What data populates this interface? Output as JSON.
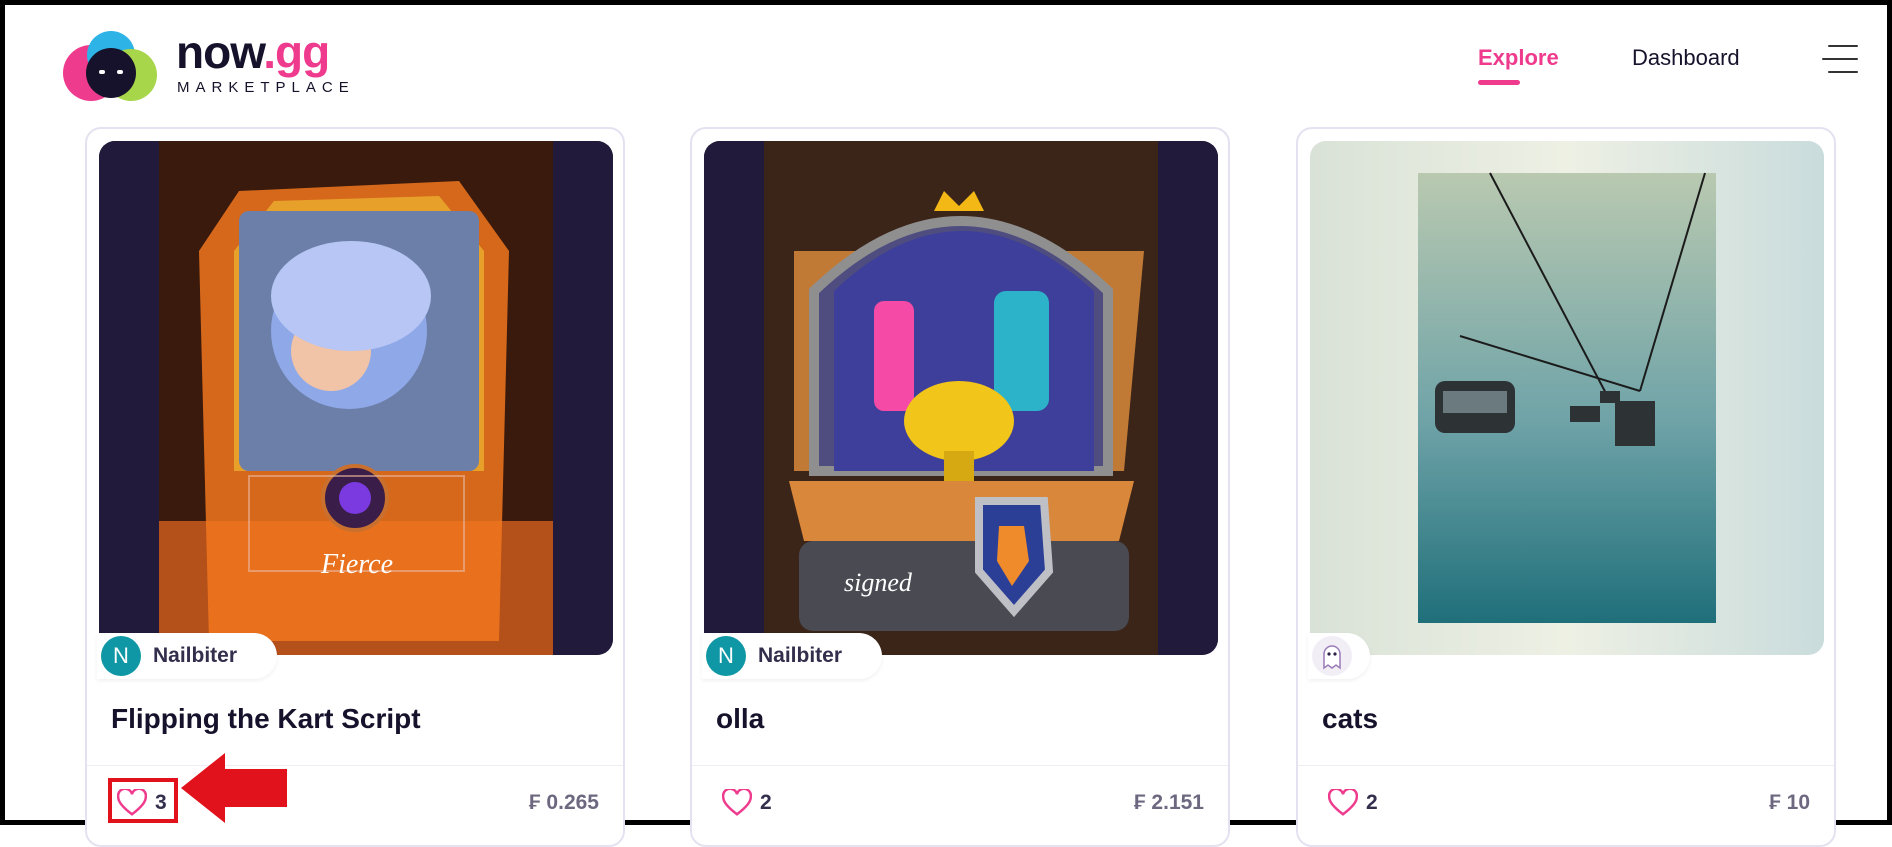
{
  "header": {
    "logo_word": "now",
    "logo_gg": ".gg",
    "logo_sub": "MARKETPLACE",
    "nav": {
      "explore": "Explore",
      "dashboard": "Dashboard"
    }
  },
  "cards": [
    {
      "creator": "Nailbiter",
      "avatar_letter": "N",
      "title": "Flipping the Kart Script",
      "likes": "3",
      "price": "₣ 0.265",
      "card_text": "Fierce"
    },
    {
      "creator": "Nailbiter",
      "avatar_letter": "N",
      "title": "olla",
      "likes": "2",
      "price": "₣ 2.151",
      "card_text": "signed"
    },
    {
      "creator": "",
      "avatar_letter": "",
      "title": "cats",
      "likes": "2",
      "price": "₣ 10"
    }
  ],
  "colors": {
    "accent": "#ef3b8d",
    "avatar": "#0f97a5",
    "annotation": "#e1121c"
  }
}
